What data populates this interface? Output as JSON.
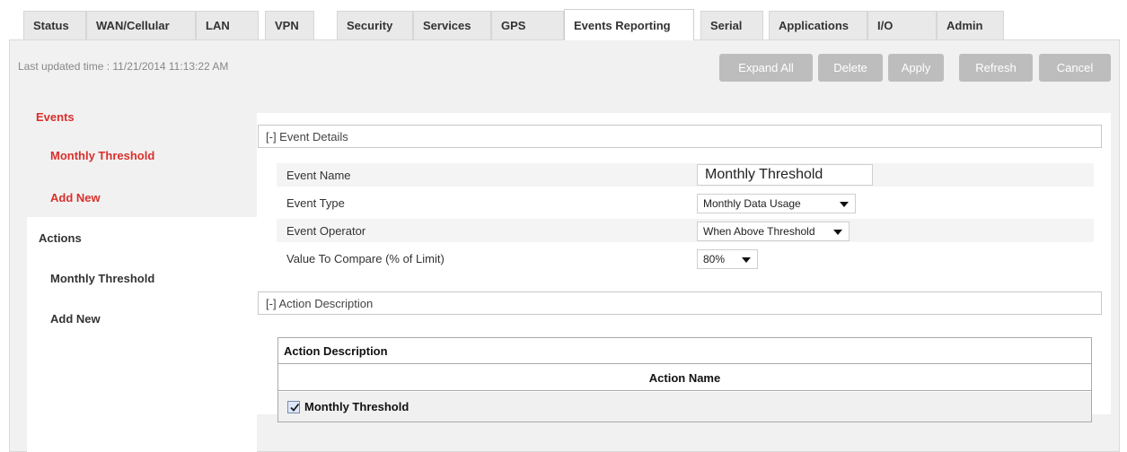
{
  "tabs": [
    {
      "label": "Status"
    },
    {
      "label": "WAN/Cellular"
    },
    {
      "label": "LAN"
    },
    {
      "label": "VPN"
    },
    {
      "label": "Security"
    },
    {
      "label": "Services"
    },
    {
      "label": "GPS"
    },
    {
      "label": "Events Reporting",
      "active": true
    },
    {
      "label": "Serial"
    },
    {
      "label": "Applications"
    },
    {
      "label": "I/O"
    },
    {
      "label": "Admin"
    }
  ],
  "header": {
    "last_updated": "Last updated time : 11/21/2014 11:13:22 AM"
  },
  "toolbar": {
    "expand_all": "Expand All",
    "delete": "Delete",
    "apply": "Apply",
    "refresh": "Refresh",
    "cancel": "Cancel"
  },
  "sidebar": {
    "events_heading": "Events",
    "events_items": [
      "Monthly Threshold",
      "Add New"
    ],
    "actions_heading": "Actions",
    "actions_items": [
      "Monthly Threshold",
      "Add New"
    ]
  },
  "event_details": {
    "header": "[-] Event Details",
    "fields": {
      "event_name": {
        "label": "Event Name",
        "value": "Monthly Threshold"
      },
      "event_type": {
        "label": "Event Type",
        "value": "Monthly Data Usage"
      },
      "event_operator": {
        "label": "Event Operator",
        "value": "When Above Threshold"
      },
      "value_to_compare": {
        "label": "Value To Compare (% of Limit)",
        "value": "80%"
      }
    }
  },
  "action_description": {
    "header": "[-] Action Description",
    "table_title": "Action Description",
    "column_header": "Action Name",
    "rows": [
      {
        "name": "Monthly Threshold",
        "checked": true
      }
    ]
  },
  "colors": {
    "accent_red": "#d9302c",
    "button_gray": "#bdbdbd",
    "tab_gray": "#e9e9e9"
  }
}
